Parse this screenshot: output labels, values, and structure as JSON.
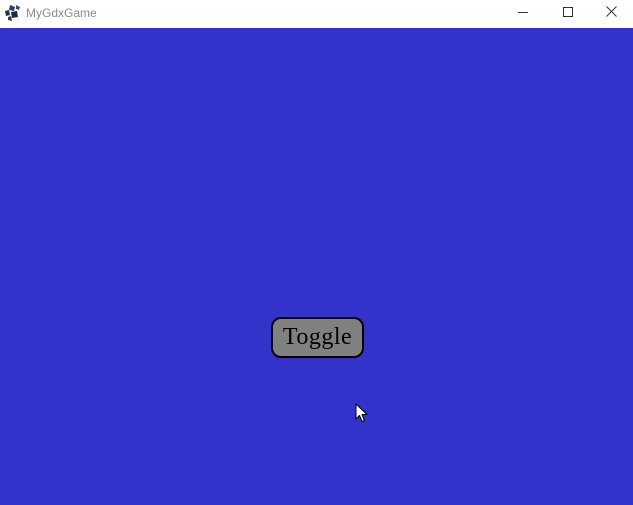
{
  "window": {
    "title": "MyGdxGame",
    "icon": "libgdx-logo-icon",
    "controls": {
      "minimize_icon": "minimize-icon",
      "maximize_icon": "maximize-icon",
      "close_icon": "close-icon"
    }
  },
  "game": {
    "background_color": "#3333cc",
    "toggle_button": {
      "label": "Toggle",
      "fill_color": "#808080",
      "border_color": "#000000"
    }
  },
  "cursor": {
    "icon": "mouse-pointer-icon"
  }
}
